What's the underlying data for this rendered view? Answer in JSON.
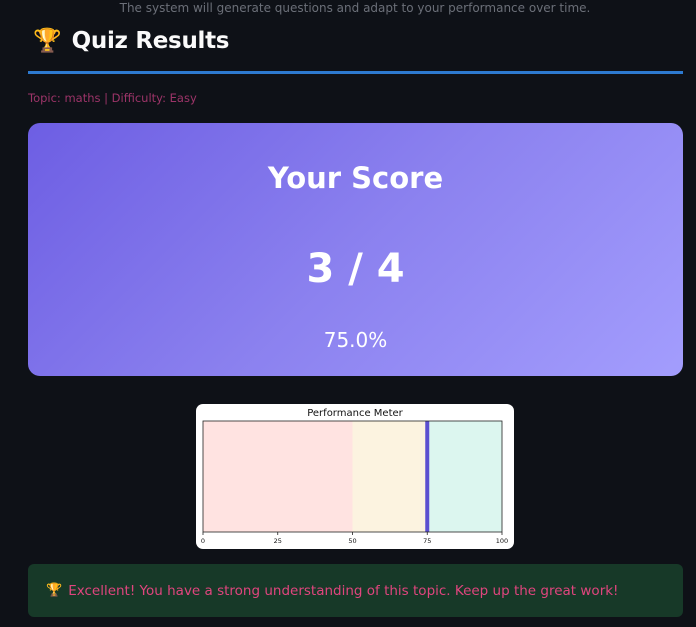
{
  "header": {
    "caption": "The system will generate questions and adapt to your performance over time.",
    "title_icon": "trophy-icon",
    "title": "Quiz Results"
  },
  "topic_line": "Topic: maths | Difficulty: Easy",
  "score_card": {
    "heading": "Your Score",
    "score": "3 / 4",
    "percent": "75.0%",
    "gradient_start": "#6d5ee3",
    "gradient_end": "#a39dfd"
  },
  "chart_data": {
    "type": "bar",
    "title": "Performance Meter",
    "orientation": "horizontal",
    "xlim": [
      0,
      100
    ],
    "xticks": [
      0,
      25,
      50,
      75,
      100
    ],
    "xtick_labels": [
      "0",
      "25",
      "50",
      "75",
      "100"
    ],
    "bands": [
      {
        "from": 0,
        "to": 50,
        "color": "#ffe3e1"
      },
      {
        "from": 50,
        "to": 75,
        "color": "#fcf3e0"
      },
      {
        "from": 75,
        "to": 100,
        "color": "#dcf6ef"
      }
    ],
    "value": 75,
    "marker_color": "#5b4fd0",
    "grid": false,
    "legend": "none"
  },
  "feedback": {
    "icon": "trophy-icon",
    "message": "Excellent! You have a strong understanding of this topic. Keep up the great work!",
    "background": "#173928",
    "text_color": "#e0457e"
  }
}
